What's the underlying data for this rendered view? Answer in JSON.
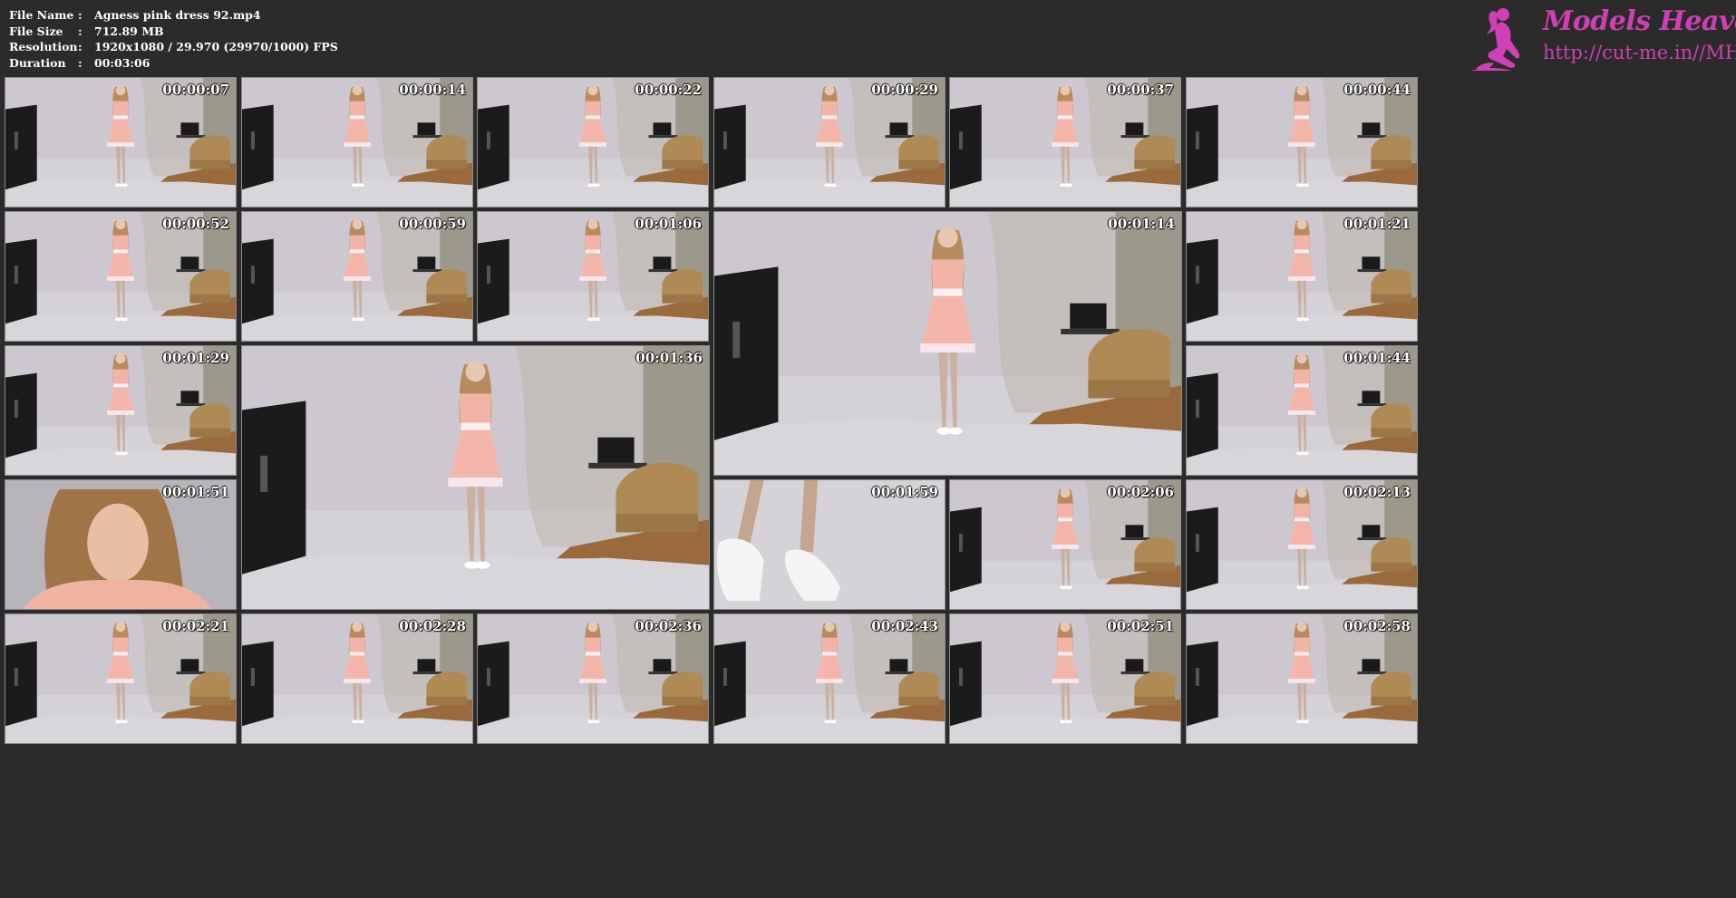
{
  "file_info": {
    "file_name_label": "File Name",
    "file_name": "Agness pink dress 92.mp4",
    "file_size_label": "File Size",
    "file_size": "712.89 MB",
    "resolution_label": "Resolution",
    "resolution": "1920x1080 / 29.970 (29970/1000) FPS",
    "duration_label": "Duration",
    "duration": "00:03:06",
    "separator": ":"
  },
  "logo": {
    "title": "Models Heaven",
    "url": "http://cut-me.in//MH",
    "color": "#d03fb5"
  },
  "thumbnails": [
    {
      "timestamp": "00:00:07",
      "kind": "full"
    },
    {
      "timestamp": "00:00:14",
      "kind": "full"
    },
    {
      "timestamp": "00:00:22",
      "kind": "full"
    },
    {
      "timestamp": "00:00:29",
      "kind": "full"
    },
    {
      "timestamp": "00:00:37",
      "kind": "full"
    },
    {
      "timestamp": "00:00:44",
      "kind": "full"
    },
    {
      "timestamp": "00:00:52",
      "kind": "full"
    },
    {
      "timestamp": "00:00:59",
      "kind": "full"
    },
    {
      "timestamp": "00:01:06",
      "kind": "back"
    },
    {
      "timestamp": "00:01:14",
      "kind": "back-large"
    },
    {
      "timestamp": "00:01:21",
      "kind": "full"
    },
    {
      "timestamp": "00:01:29",
      "kind": "full"
    },
    {
      "timestamp": "00:01:36",
      "kind": "front-large"
    },
    {
      "timestamp": "00:01:44",
      "kind": "full"
    },
    {
      "timestamp": "00:01:51",
      "kind": "face"
    },
    {
      "timestamp": "00:01:59",
      "kind": "shoes"
    },
    {
      "timestamp": "00:02:06",
      "kind": "full"
    },
    {
      "timestamp": "00:02:13",
      "kind": "full"
    },
    {
      "timestamp": "00:02:21",
      "kind": "full"
    },
    {
      "timestamp": "00:02:28",
      "kind": "full"
    },
    {
      "timestamp": "00:02:36",
      "kind": "full"
    },
    {
      "timestamp": "00:02:43",
      "kind": "full"
    },
    {
      "timestamp": "00:02:51",
      "kind": "crouch"
    },
    {
      "timestamp": "00:02:58",
      "kind": "kneel"
    }
  ]
}
